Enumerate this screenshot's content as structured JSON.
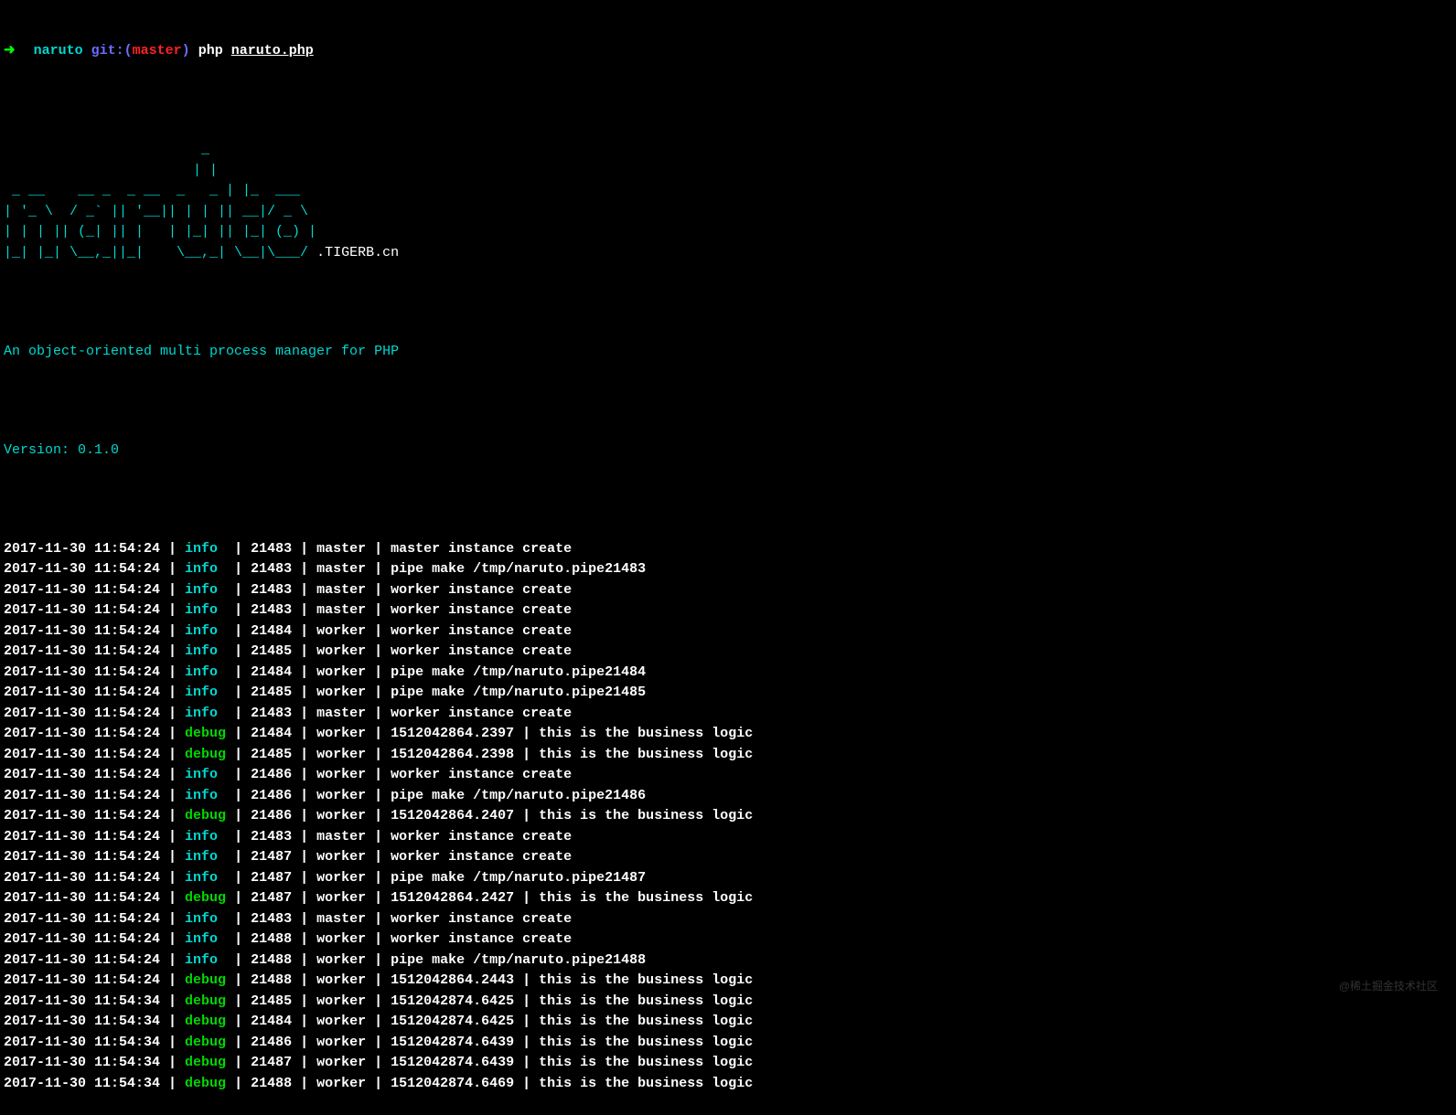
{
  "prompt": {
    "arrow": "➜",
    "dir": "naruto",
    "git_label": "git:(",
    "branch": "master",
    "git_close": ")",
    "command": "php",
    "file": "naruto.php"
  },
  "ascii_art": [
    "                        _",
    "                       | |",
    " _ __    __ _  _ __  _   _ | |_  ___",
    "| '_ \\  / _` || '__|| | | || __|/ _ \\",
    "| | | || (_| || |   | |_| || |_| (_) |",
    "|_| |_| \\__,_||_|    \\__,_| \\__|\\___/ "
  ],
  "tigerb_suffix": ".TIGERB.cn",
  "subtitle": "An object-oriented multi process manager for PHP",
  "version": "Version: 0.1.0",
  "logs": [
    {
      "ts": "2017-11-30 11:54:24",
      "level": "info",
      "pid": "21483",
      "role": "master",
      "msg": "master instance create"
    },
    {
      "ts": "2017-11-30 11:54:24",
      "level": "info",
      "pid": "21483",
      "role": "master",
      "msg": "pipe make /tmp/naruto.pipe21483"
    },
    {
      "ts": "2017-11-30 11:54:24",
      "level": "info",
      "pid": "21483",
      "role": "master",
      "msg": "worker instance create"
    },
    {
      "ts": "2017-11-30 11:54:24",
      "level": "info",
      "pid": "21483",
      "role": "master",
      "msg": "worker instance create"
    },
    {
      "ts": "2017-11-30 11:54:24",
      "level": "info",
      "pid": "21484",
      "role": "worker",
      "msg": "worker instance create"
    },
    {
      "ts": "2017-11-30 11:54:24",
      "level": "info",
      "pid": "21485",
      "role": "worker",
      "msg": "worker instance create"
    },
    {
      "ts": "2017-11-30 11:54:24",
      "level": "info",
      "pid": "21484",
      "role": "worker",
      "msg": "pipe make /tmp/naruto.pipe21484"
    },
    {
      "ts": "2017-11-30 11:54:24",
      "level": "info",
      "pid": "21485",
      "role": "worker",
      "msg": "pipe make /tmp/naruto.pipe21485"
    },
    {
      "ts": "2017-11-30 11:54:24",
      "level": "info",
      "pid": "21483",
      "role": "master",
      "msg": "worker instance create"
    },
    {
      "ts": "2017-11-30 11:54:24",
      "level": "debug",
      "pid": "21484",
      "role": "worker",
      "msg": "1512042864.2397 | this is the business logic"
    },
    {
      "ts": "2017-11-30 11:54:24",
      "level": "debug",
      "pid": "21485",
      "role": "worker",
      "msg": "1512042864.2398 | this is the business logic"
    },
    {
      "ts": "2017-11-30 11:54:24",
      "level": "info",
      "pid": "21486",
      "role": "worker",
      "msg": "worker instance create"
    },
    {
      "ts": "2017-11-30 11:54:24",
      "level": "info",
      "pid": "21486",
      "role": "worker",
      "msg": "pipe make /tmp/naruto.pipe21486"
    },
    {
      "ts": "2017-11-30 11:54:24",
      "level": "debug",
      "pid": "21486",
      "role": "worker",
      "msg": "1512042864.2407 | this is the business logic"
    },
    {
      "ts": "2017-11-30 11:54:24",
      "level": "info",
      "pid": "21483",
      "role": "master",
      "msg": "worker instance create"
    },
    {
      "ts": "2017-11-30 11:54:24",
      "level": "info",
      "pid": "21487",
      "role": "worker",
      "msg": "worker instance create"
    },
    {
      "ts": "2017-11-30 11:54:24",
      "level": "info",
      "pid": "21487",
      "role": "worker",
      "msg": "pipe make /tmp/naruto.pipe21487"
    },
    {
      "ts": "2017-11-30 11:54:24",
      "level": "debug",
      "pid": "21487",
      "role": "worker",
      "msg": "1512042864.2427 | this is the business logic"
    },
    {
      "ts": "2017-11-30 11:54:24",
      "level": "info",
      "pid": "21483",
      "role": "master",
      "msg": "worker instance create"
    },
    {
      "ts": "2017-11-30 11:54:24",
      "level": "info",
      "pid": "21488",
      "role": "worker",
      "msg": "worker instance create"
    },
    {
      "ts": "2017-11-30 11:54:24",
      "level": "info",
      "pid": "21488",
      "role": "worker",
      "msg": "pipe make /tmp/naruto.pipe21488"
    },
    {
      "ts": "2017-11-30 11:54:24",
      "level": "debug",
      "pid": "21488",
      "role": "worker",
      "msg": "1512042864.2443 | this is the business logic"
    },
    {
      "ts": "2017-11-30 11:54:34",
      "level": "debug",
      "pid": "21485",
      "role": "worker",
      "msg": "1512042874.6425 | this is the business logic"
    },
    {
      "ts": "2017-11-30 11:54:34",
      "level": "debug",
      "pid": "21484",
      "role": "worker",
      "msg": "1512042874.6425 | this is the business logic"
    },
    {
      "ts": "2017-11-30 11:54:34",
      "level": "debug",
      "pid": "21486",
      "role": "worker",
      "msg": "1512042874.6439 | this is the business logic"
    },
    {
      "ts": "2017-11-30 11:54:34",
      "level": "debug",
      "pid": "21487",
      "role": "worker",
      "msg": "1512042874.6439 | this is the business logic"
    },
    {
      "ts": "2017-11-30 11:54:34",
      "level": "debug",
      "pid": "21488",
      "role": "worker",
      "msg": "1512042874.6469 | this is the business logic"
    }
  ],
  "watermark": "@稀土掘金技术社区"
}
